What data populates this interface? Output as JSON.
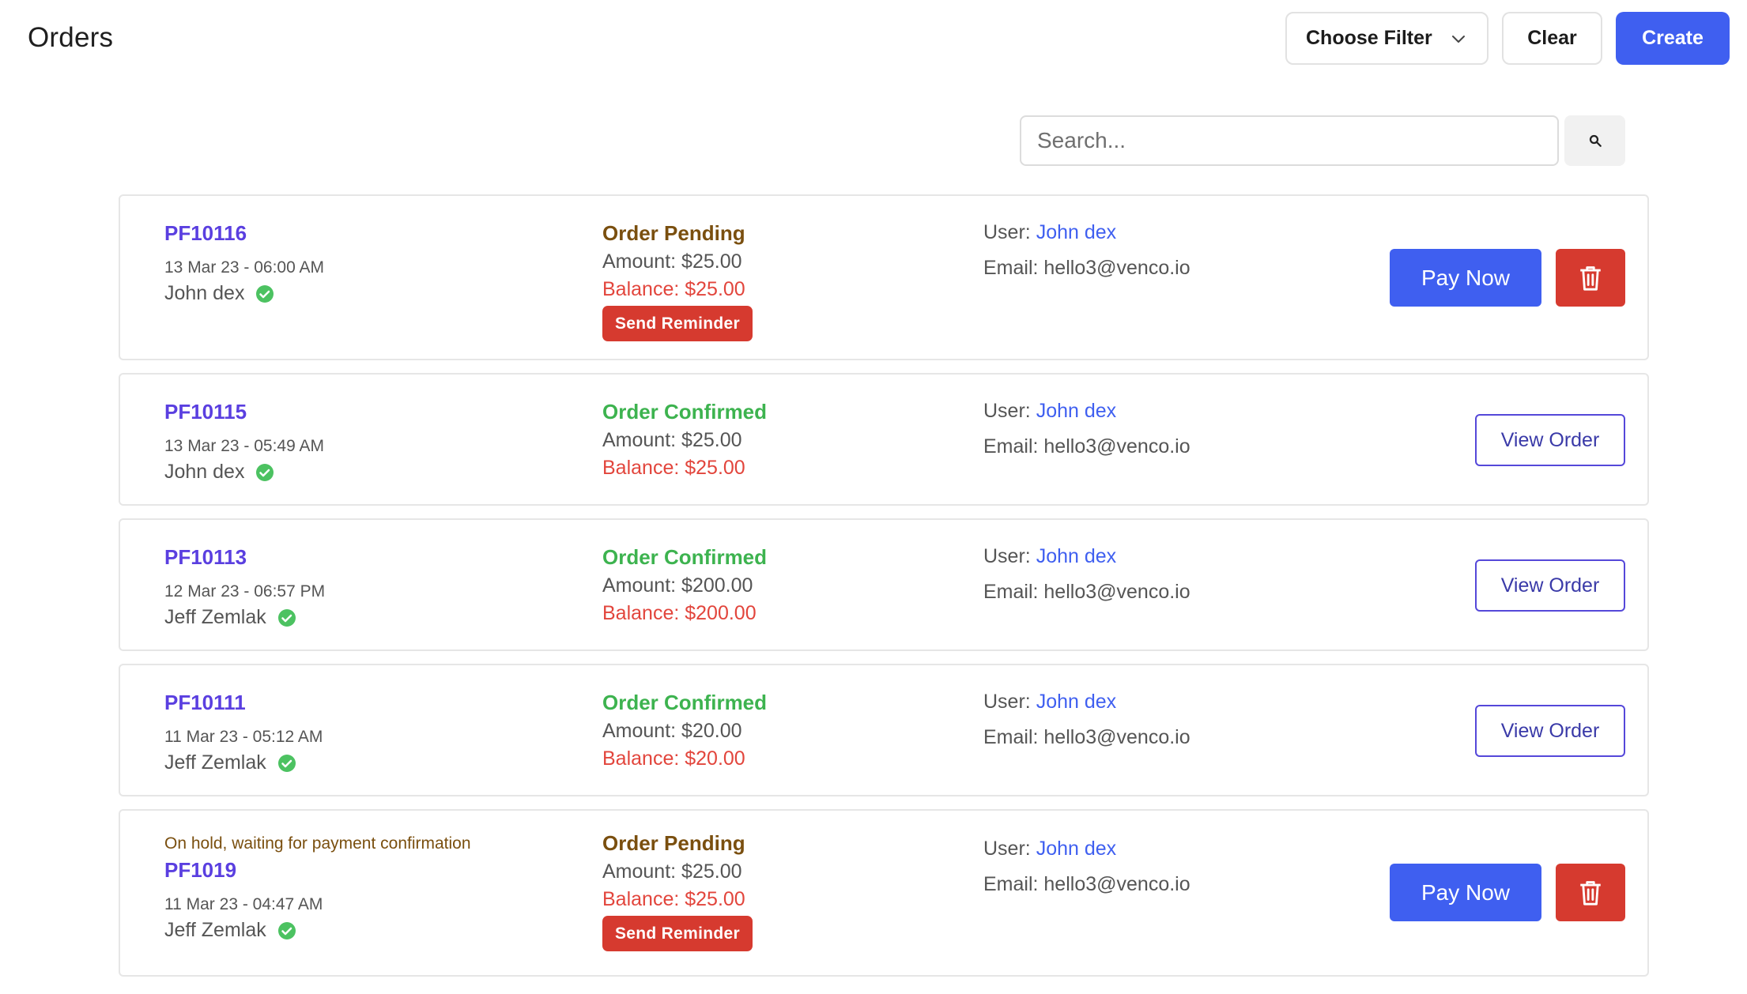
{
  "page": {
    "title": "Orders"
  },
  "toolbar": {
    "filter_label": "Choose Filter",
    "clear_label": "Clear",
    "create_label": "Create"
  },
  "search": {
    "placeholder": "Search..."
  },
  "labels": {
    "user_prefix": "User: ",
    "email_prefix": "Email: ",
    "pay_now": "Pay Now",
    "view_order": "View Order",
    "send_reminder": "Send Reminder"
  },
  "colors": {
    "accent": "#3f5ff0",
    "order_id": "#5a3fe0",
    "pending": "#7a4f0f",
    "confirmed": "#3db34f",
    "balance": "#e2453c",
    "danger": "#d63a2f"
  },
  "orders": [
    {
      "id": "PF10116",
      "date": "13 Mar 23 - 06:00 AM",
      "customer": "John dex",
      "status": "Order Pending",
      "amount": "Amount: $25.00",
      "balance": "Balance: $25.00",
      "user": "John dex",
      "email": "hello3@venco.io"
    },
    {
      "id": "PF10115",
      "date": "13 Mar 23 - 05:49 AM",
      "customer": "John dex",
      "status": "Order Confirmed",
      "amount": "Amount: $25.00",
      "balance": "Balance: $25.00",
      "user": "John dex",
      "email": "hello3@venco.io"
    },
    {
      "id": "PF10113",
      "date": "12 Mar 23 - 06:57 PM",
      "customer": "Jeff Zemlak",
      "status": "Order Confirmed",
      "amount": "Amount: $200.00",
      "balance": "Balance: $200.00",
      "user": "John dex",
      "email": "hello3@venco.io"
    },
    {
      "id": "PF10111",
      "date": "11 Mar 23 - 05:12 AM",
      "customer": "Jeff Zemlak",
      "status": "Order Confirmed",
      "amount": "Amount: $20.00",
      "balance": "Balance: $20.00",
      "user": "John dex",
      "email": "hello3@venco.io"
    },
    {
      "note": "On hold, waiting for payment confirmation",
      "id": "PF1019",
      "date": "11 Mar 23 - 04:47 AM",
      "customer": "Jeff Zemlak",
      "status": "Order Pending",
      "amount": "Amount: $25.00",
      "balance": "Balance: $25.00",
      "user": "John dex",
      "email": "hello3@venco.io"
    }
  ]
}
